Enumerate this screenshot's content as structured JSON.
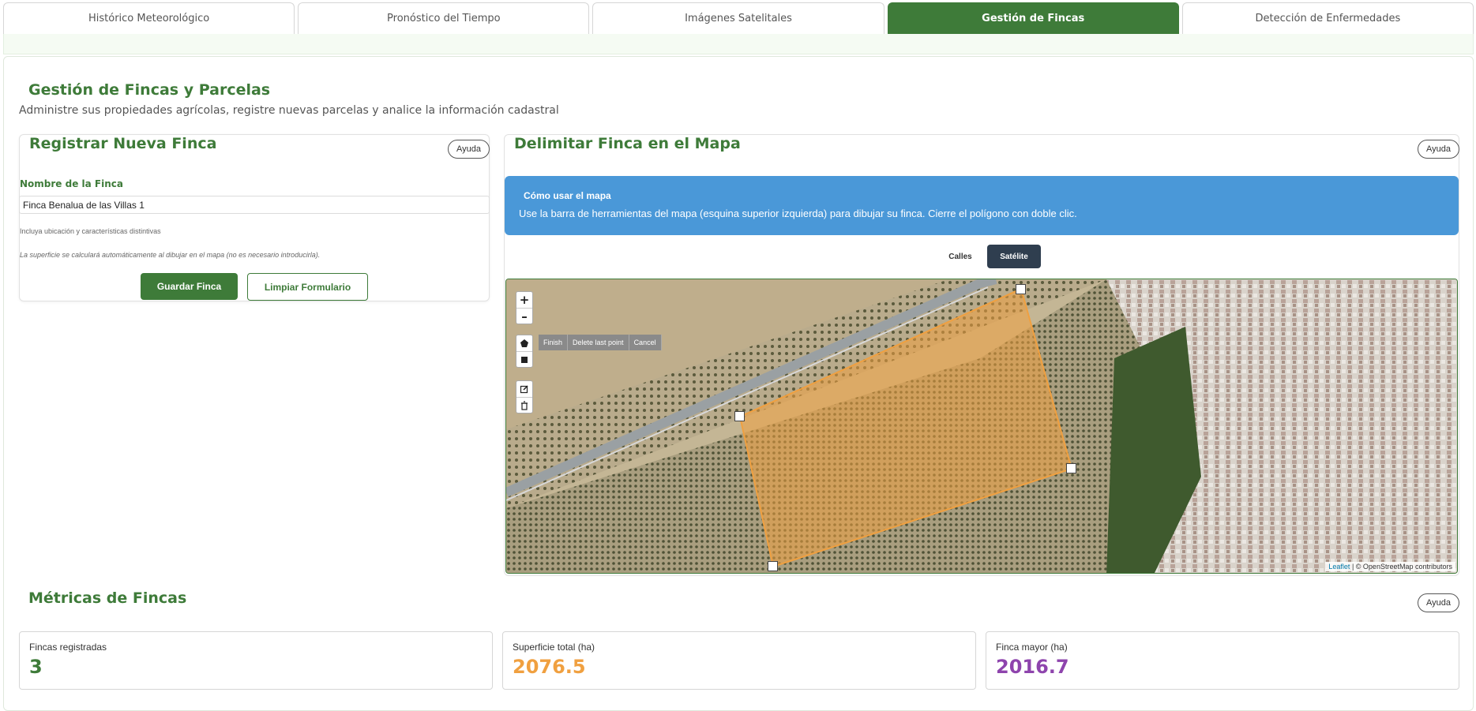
{
  "tabs": [
    {
      "label": "Histórico Meteorológico",
      "active": false
    },
    {
      "label": "Pronóstico del Tiempo",
      "active": false
    },
    {
      "label": "Imágenes Satelitales",
      "active": false
    },
    {
      "label": "Gestión de Fincas",
      "active": true
    },
    {
      "label": "Detección de Enfermedades",
      "active": false
    }
  ],
  "page": {
    "title": "Gestión de Fincas y Parcelas",
    "subtitle": "Administre sus propiedades agrícolas, registre nuevas parcelas y analice la información cadastral"
  },
  "register": {
    "title": "Registrar Nueva Finca",
    "help": "Ayuda",
    "name_label": "Nombre de la Finca",
    "name_value": "Finca Benalua de las Villas 1",
    "hint": "Incluya ubicación y características distintivas",
    "surface_note": "La superficie se calculará automáticamente al dibujar en el mapa (no es necesario introducirla).",
    "save_label": "Guardar Finca",
    "clear_label": "Limpiar Formulario"
  },
  "map_section": {
    "title": "Delimitar Finca en el Mapa",
    "help": "Ayuda",
    "info_title": "Cómo usar el mapa",
    "info_text": "Use la barra de herramientas del mapa (esquina superior izquierda) para dibujar su finca. Cierre el polígono con doble clic.",
    "layer_streets": "Calles",
    "layer_satellite": "Satélite",
    "active_layer": "Satélite",
    "zoom_in": "+",
    "zoom_out": "–",
    "draw_finish": "Finish",
    "draw_delete_last": "Delete last point",
    "draw_cancel": "Cancel",
    "attribution_leaflet": "Leaflet",
    "attribution_osm": "© OpenStreetMap contributors",
    "polygon_color": "#f0a040"
  },
  "metrics": {
    "title": "Métricas de Fincas",
    "help": "Ayuda",
    "items": [
      {
        "label": "Fincas registradas",
        "value": "3",
        "color": "#3e7b39"
      },
      {
        "label": "Superficie total (ha)",
        "value": "2076.5",
        "color": "#f0a040"
      },
      {
        "label": "Finca mayor (ha)",
        "value": "2016.7",
        "color": "#8e44ad"
      }
    ]
  },
  "colors": {
    "brand_green": "#3e7b39",
    "info_blue": "#4a98d8",
    "dark_button": "#2f3e4f"
  }
}
